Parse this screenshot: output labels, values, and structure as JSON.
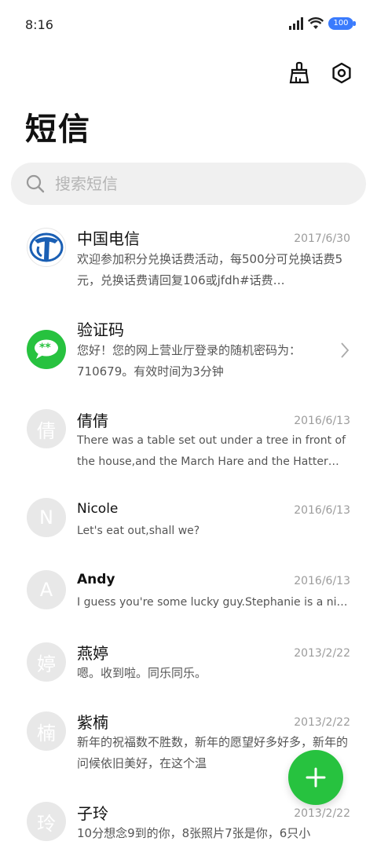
{
  "status_bar": {
    "time": "8:16",
    "battery": "100"
  },
  "header": {
    "title": "短信"
  },
  "search": {
    "placeholder": "搜索短信"
  },
  "conversations": [
    {
      "name": "中国电信",
      "date": "2017/6/30",
      "preview": "欢迎参加积分兑换话费活动，每500分可兑换话费5元，兑换话费请回复106或jfdh#话费…",
      "avatar_type": "telecom-logo"
    },
    {
      "name": "验证码",
      "date": "",
      "preview": "您好！您的网上营业厅登录的随机密码为：710679。有效时间为3分钟",
      "avatar_type": "chat-logo",
      "avatar_text": "**"
    },
    {
      "name": "倩倩",
      "date": "2016/6/13",
      "preview": "There was a table set out under a tree in front of the house,and the March Hare and the Hatter were having…",
      "avatar_text": "倩"
    },
    {
      "name": "Nicole",
      "date": "2016/6/13",
      "preview": "Let's eat out,shall we?",
      "avatar_text": "N"
    },
    {
      "name": "Andy",
      "date": "2016/6/13",
      "preview": "I guess you're some lucky guy.Stephanie is a nice girl.",
      "avatar_text": "A"
    },
    {
      "name": "燕婷",
      "date": "2013/2/22",
      "preview": "嗯。收到啦。同乐同乐。",
      "avatar_text": "婷"
    },
    {
      "name": "紫楠",
      "date": "2013/2/22",
      "preview": "新年的祝福数不胜数，新年的愿望好多好多，新年的问候依旧美好，在这个温",
      "avatar_text": "楠"
    },
    {
      "name": "子玲",
      "date": "2013/2/22",
      "preview": "10分想念9到的你，8张照片7张是你，6只小",
      "avatar_text": "玲"
    }
  ],
  "colors": {
    "accent_green": "#27c23f",
    "battery_blue": "#3a7bfd",
    "telecom_blue": "#1a5fb4"
  }
}
